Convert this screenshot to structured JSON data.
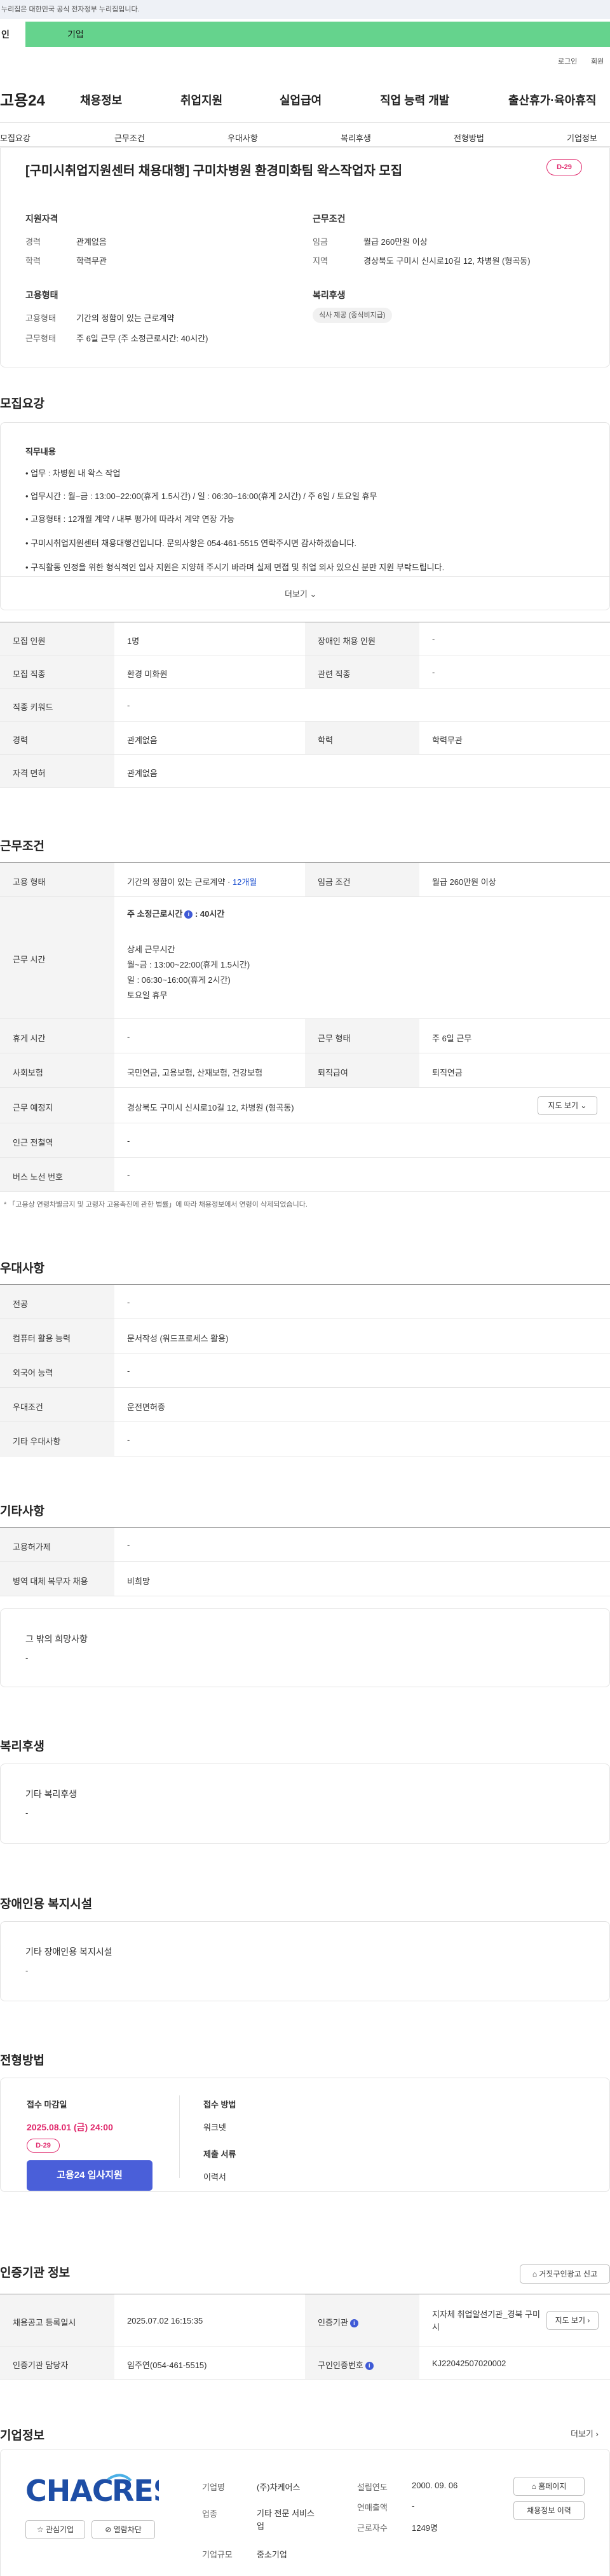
{
  "gov_notice": "누리집은 대한민국 공식 전자정부 누리집입니다.",
  "tabs": {
    "person": "인",
    "business": "기업"
  },
  "util": {
    "login": "로그인",
    "join": "회원"
  },
  "logo": "고용24",
  "gnb": [
    "채용정보",
    "취업지원",
    "실업급여",
    "직업 능력 개발",
    "출산휴가·육아휴직"
  ],
  "subnav": [
    "모집요강",
    "근무조건",
    "우대사항",
    "복리후생",
    "전형방법",
    "기업정보"
  ],
  "job": {
    "title": "[구미시취업지원센터 채용대행] 구미차병원 환경미화팀 왁스작업자 모집",
    "dday": "D-29",
    "qual_label": "지원자격",
    "career_k": "경력",
    "career_v": "관계없음",
    "edu_k": "학력",
    "edu_v": "학력무관",
    "emp_label": "고용형태",
    "emp_k": "고용형태",
    "emp_v": "기간의 정함이 있는 근로계약",
    "work_k": "근무형태",
    "work_v": "주 6일 근무 (주 소정근로시간: 40시간)",
    "cond_label": "근무조건",
    "wage_k": "임금",
    "wage_v": "월급 260만원 이상",
    "area_k": "지역",
    "area_v": "경상북도 구미시 신시로10길 12, 차병원 (형곡동)",
    "welfare_label": "복리후생",
    "welfare_chip": "식사 제공 (중식비지급)"
  },
  "recruit": {
    "heading": "모집요강",
    "duty_label": "직무내용",
    "lines": [
      "• 업무 : 차병원 내 왁스 작업",
      "• 업무시간 : 월~금 : 13:00~22:00(휴게 1.5시간) / 일 : 06:30~16:00(휴게 2시간) / 주 6일 / 토요일 휴무",
      "• 고용형태 : 12개월 계약 / 내부 평가에 따라서 계약 연장 가능",
      "• 구미시취업지원센터 채용대행건입니다. 문의사항은 054-461-5515 연락주시면 감사하겠습니다.",
      "• 구직활동 인정을 위한 형식적인 입사 지원은 지양해 주시기 바라며 실제 면접 및 취업 의사 있으신 분만 지원 부탁드립니다."
    ],
    "more": "더보기 ⌄",
    "rows": [
      {
        "k1": "모집 인원",
        "v1": "1명",
        "k2": "장애인 채용 인원",
        "v2": "-"
      },
      {
        "k1": "모집 직종",
        "v1": "환경 미화원",
        "k2": "관련 직종",
        "v2": "-"
      },
      {
        "k1": "직종 키워드",
        "v1": "-",
        "k2": "",
        "v2": ""
      },
      {
        "k1": "경력",
        "v1": "관계없음",
        "k2": "학력",
        "v2": "학력무관"
      },
      {
        "k1": "자격 면허",
        "v1": "관계없음",
        "k2": "",
        "v2": ""
      }
    ]
  },
  "work": {
    "heading": "근무조건",
    "emp_k": "고용 형태",
    "emp_v": "기간의 정함이 있는 근로계약 · ",
    "emp_v_link": "12개월",
    "wage_k": "임금 조건",
    "wage_v": "월급 260만원 이상",
    "time_k": "근무 시간",
    "time_main": "주 소정근로시간",
    "time_main_v": ": 40시간",
    "detail_label": "상세 근무시간",
    "detail_lines": [
      "월~금 : 13:00~22:00(휴게 1.5시간)",
      "일 : 06:30~16:00(휴게 2시간)",
      "토요일 휴무"
    ],
    "rest_k": "휴게 시간",
    "rest_v": "-",
    "type_k": "근무 형태",
    "type_v": "주 6일 근무",
    "ins_k": "사회보험",
    "ins_v": "국민연금, 고용보험, 산재보험, 건강보험",
    "retire_k": "퇴직급여",
    "retire_v": "퇴직연금",
    "place_k": "근무 예정지",
    "place_v": "경상북도 구미시 신시로10길 12, 차병원 (형곡동)",
    "map_btn": "지도 보기 ⌄",
    "subway_k": "인근 전철역",
    "subway_v": "-",
    "bus_k": "버스 노선 번호",
    "bus_v": "-",
    "note": "* 「고용상 연령차별금지 및 고령자 고용촉진에 관한 법률」에 따라 채용정보에서 연령이 삭제되었습니다."
  },
  "pref": {
    "heading": "우대사항",
    "rows": [
      {
        "k": "전공",
        "v": "-"
      },
      {
        "k": "컴퓨터 활용 능력",
        "v": "문서작성 (워드프로세스 활용)"
      },
      {
        "k": "외국어 능력",
        "v": "-"
      },
      {
        "k": "우대조건",
        "v": "운전면허증"
      },
      {
        "k": "기타 우대사항",
        "v": "-"
      }
    ]
  },
  "etc": {
    "heading": "기타사항",
    "rows": [
      {
        "k": "고용허가제",
        "v": "-"
      },
      {
        "k": "병역 대체 복무자 채용",
        "v": "비희망"
      }
    ],
    "box_label": "그 밖의 희망사항",
    "box_v": "-"
  },
  "welfare": {
    "heading": "복리후생",
    "box_label": "기타 복리후생",
    "box_v": "-"
  },
  "disab": {
    "heading": "장애인용 복지시설",
    "box_label": "기타 장애인용 복지시설",
    "box_v": "-"
  },
  "apply": {
    "heading": "전형방법",
    "deadline_label": "접수 마감일",
    "deadline": "2025.08.01 (금) 24:00",
    "dday": "D-29",
    "apply_btn": "고용24 입사지원",
    "method_label": "접수 방법",
    "method_v": "워크넷",
    "docs_label": "제출 서류",
    "docs_v": "이력서"
  },
  "cert": {
    "heading": "인증기관 정보",
    "report_btn": "거짓구인광고 신고",
    "reg_k": "채용공고 등록일시",
    "reg_v": "2025.07.02 16:15:35",
    "org_k": "인증기관",
    "org_v": "지자체 취업알선기관_경북 구미시",
    "map_btn": "지도 보기",
    "mgr_k": "인증기관 담당자",
    "mgr_v": "임주연(054-461-5515)",
    "no_k": "구인인증번호",
    "no_v": "KJ22042507020002"
  },
  "company": {
    "heading": "기업정보",
    "more": "더보기 ›",
    "logo_text": "CHAC RES",
    "fav_btn": "관심기업",
    "block_btn": "열람차단",
    "name_k": "기업명",
    "name_v": "(주)차케어스",
    "ind_k": "업종",
    "ind_v": "기타 전문 서비스업",
    "size_k": "기업규모",
    "size_v": "중소기업",
    "est_k": "설립연도",
    "est_v": "2000. 09. 06",
    "sales_k": "연매출액",
    "sales_v": "-",
    "emp_k": "근로자수",
    "emp_v": "1249명",
    "home_btn": "홈페이지",
    "job_btn": "채용정보 이력"
  }
}
